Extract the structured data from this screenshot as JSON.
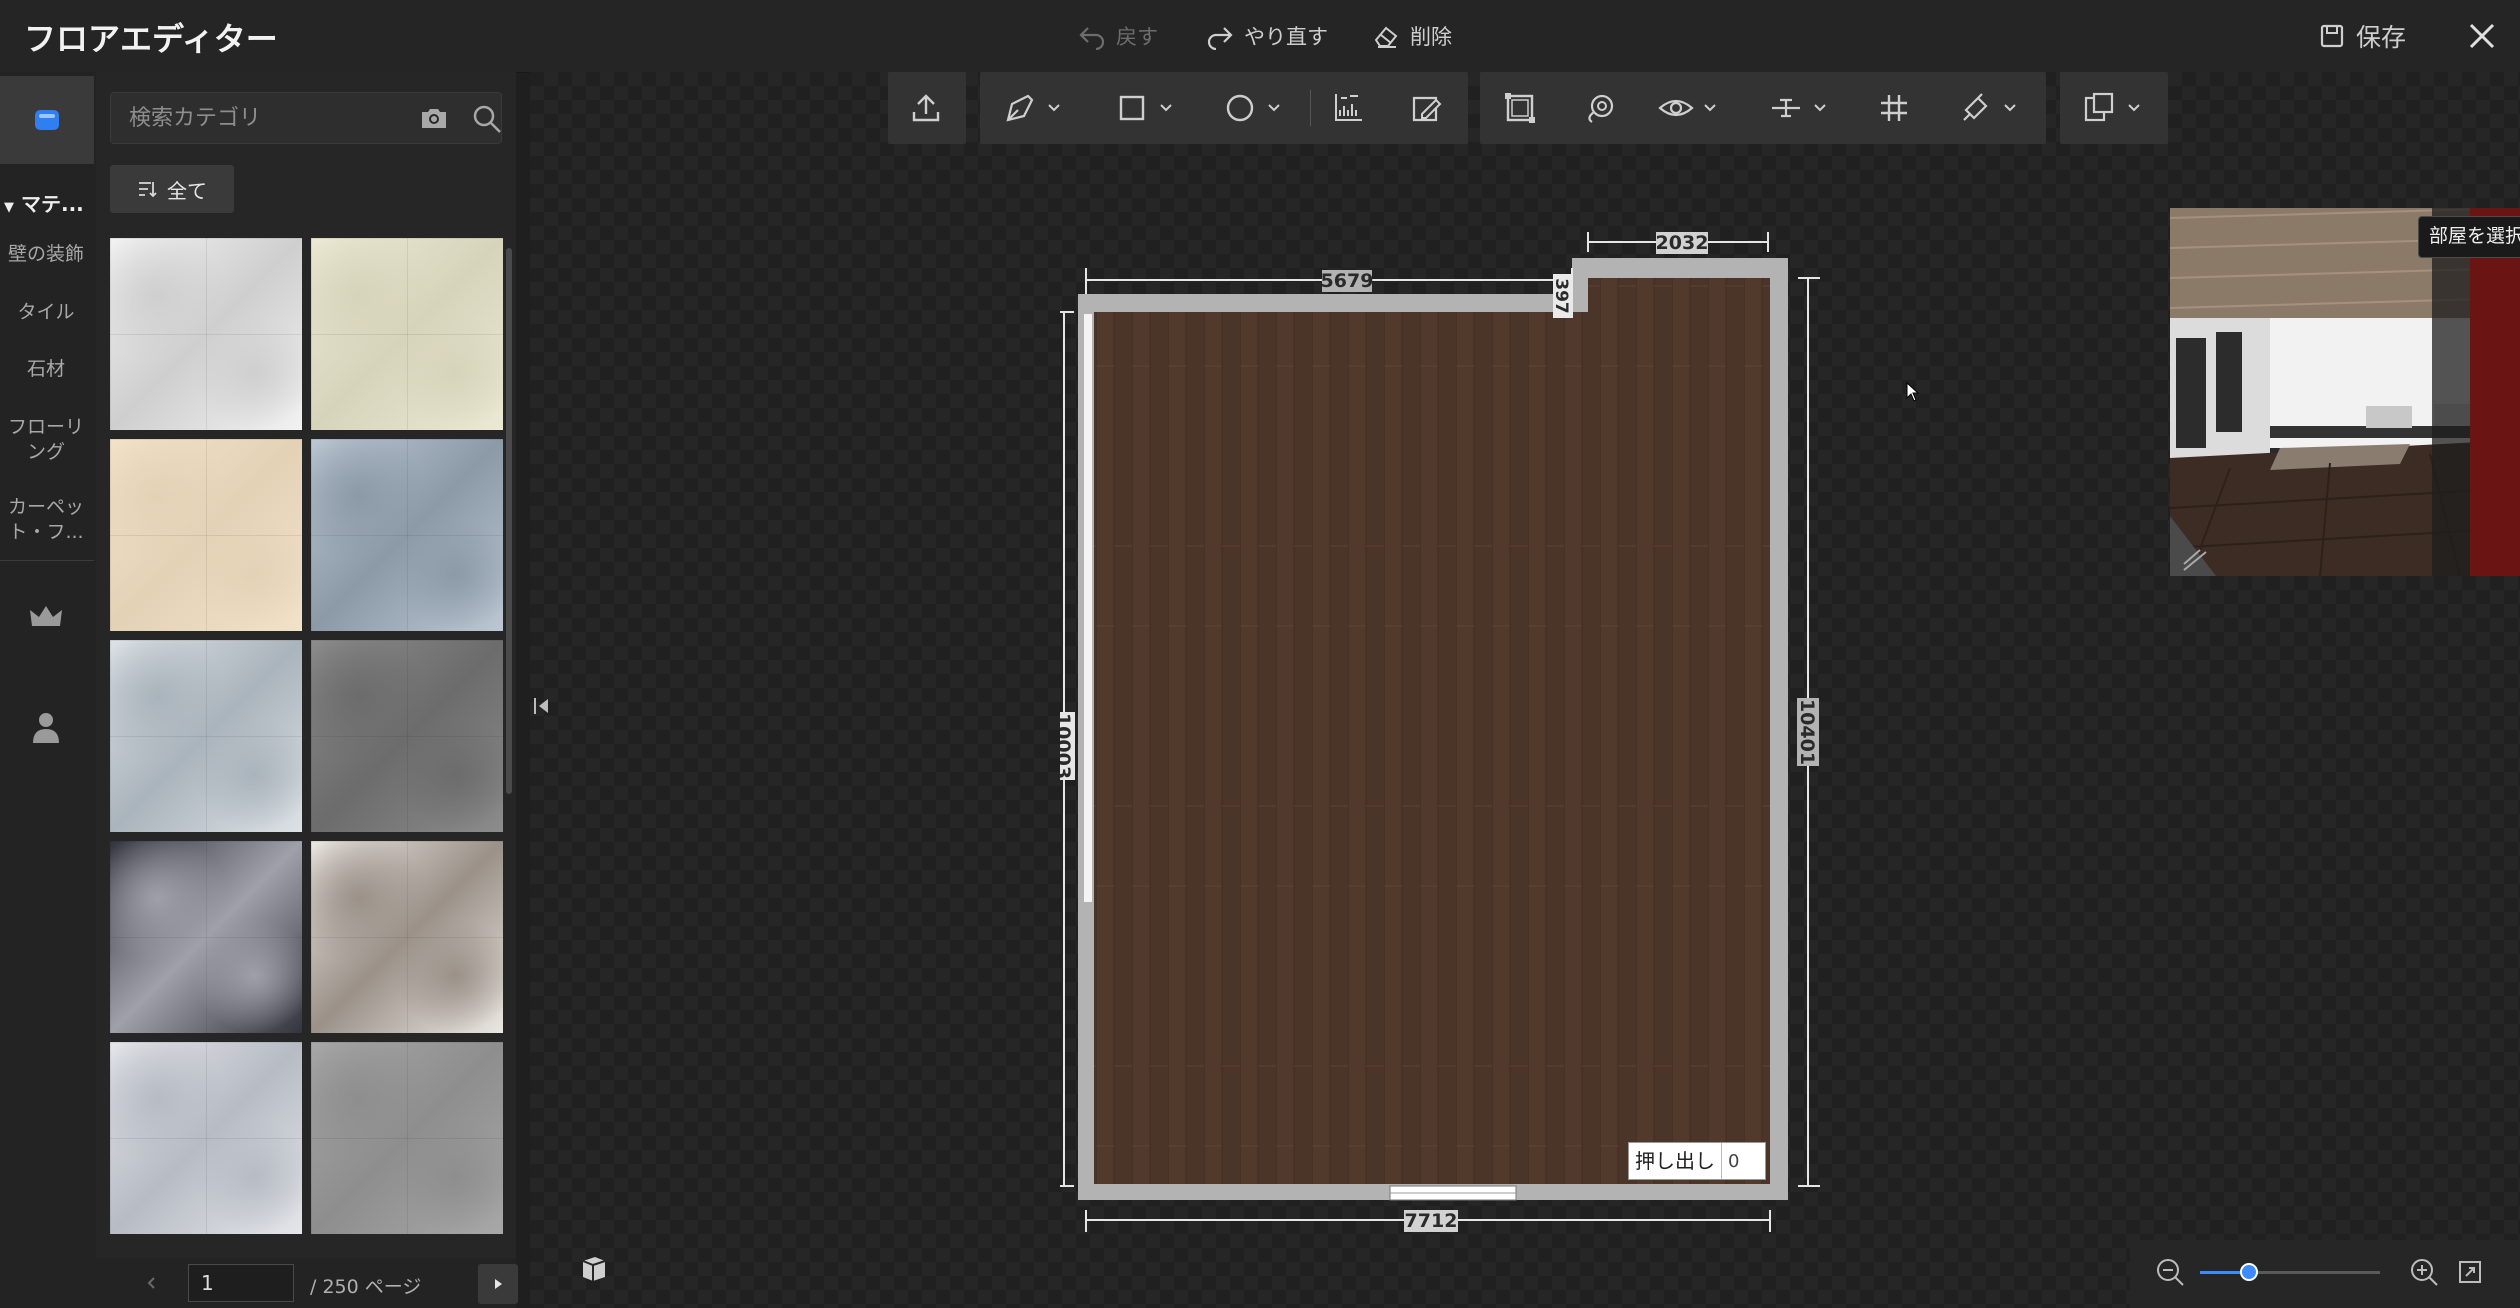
{
  "app": {
    "title": "フロアエディター"
  },
  "header": {
    "undo_label": "戻す",
    "redo_label": "やり直す",
    "delete_label": "削除",
    "save_label": "保存"
  },
  "sidebar": {
    "group_label": "マテ...",
    "categories": [
      "壁の装飾",
      "タイル",
      "石材",
      "フローリング",
      "カーペット・フ..."
    ]
  },
  "materials": {
    "search_placeholder": "検索カテゴリ",
    "filter_label": "全て",
    "tiles": [
      {
        "name": "white-marble",
        "colors": [
          "#f2f2f2",
          "#cfcfcf"
        ]
      },
      {
        "name": "cream-marble",
        "colors": [
          "#ece9d4",
          "#d7d4bc"
        ]
      },
      {
        "name": "beige-tile",
        "colors": [
          "#f2e2c8",
          "#e3d2b6"
        ]
      },
      {
        "name": "blue-gray-marble",
        "colors": [
          "#bcc7d3",
          "#8c9aa8"
        ]
      },
      {
        "name": "light-gray-marble",
        "colors": [
          "#dde2e6",
          "#aab4bc"
        ]
      },
      {
        "name": "gray-stone",
        "colors": [
          "#8c8c8c",
          "#6c6c6c"
        ]
      },
      {
        "name": "dark-granite",
        "colors": [
          "#34343e",
          "#a0a0aa"
        ]
      },
      {
        "name": "white-granite",
        "colors": [
          "#ebe7e2",
          "#9b9189"
        ]
      },
      {
        "name": "silver-marble",
        "colors": [
          "#e4e6ea",
          "#b7bcc4"
        ]
      },
      {
        "name": "gray-marble",
        "colors": [
          "#a8a8a8",
          "#8e8e8e"
        ]
      }
    ]
  },
  "pagination": {
    "current": "1",
    "total_label": "/ 250 ページ"
  },
  "floorplan": {
    "dimensions": {
      "top_left": "5679",
      "top_right": "2032",
      "step": "397",
      "left": "10003",
      "right": "10401",
      "bottom": "7712"
    },
    "floor_color": "#4a3528",
    "wall_color": "#b3b3b3"
  },
  "extrude": {
    "label": "押し出し",
    "value": "0"
  },
  "preview": {
    "tooltip": "部屋を選択"
  },
  "zoom": {
    "level": 0.27
  },
  "icons": [
    "undo-icon",
    "redo-icon",
    "eraser-icon",
    "save-icon",
    "close-icon",
    "material-box-icon",
    "crown-icon",
    "user-icon",
    "camera-icon",
    "search-icon",
    "upload-icon",
    "pen-icon",
    "rectangle-icon",
    "circle-icon",
    "measure-icon",
    "edit-area-icon",
    "select-room-icon",
    "lasso-icon",
    "eye-icon",
    "align-icon",
    "grid-icon",
    "paint-icon",
    "layers-icon",
    "3d-box-icon",
    "zoom-out-icon",
    "zoom-in-icon",
    "fit-screen-icon"
  ]
}
